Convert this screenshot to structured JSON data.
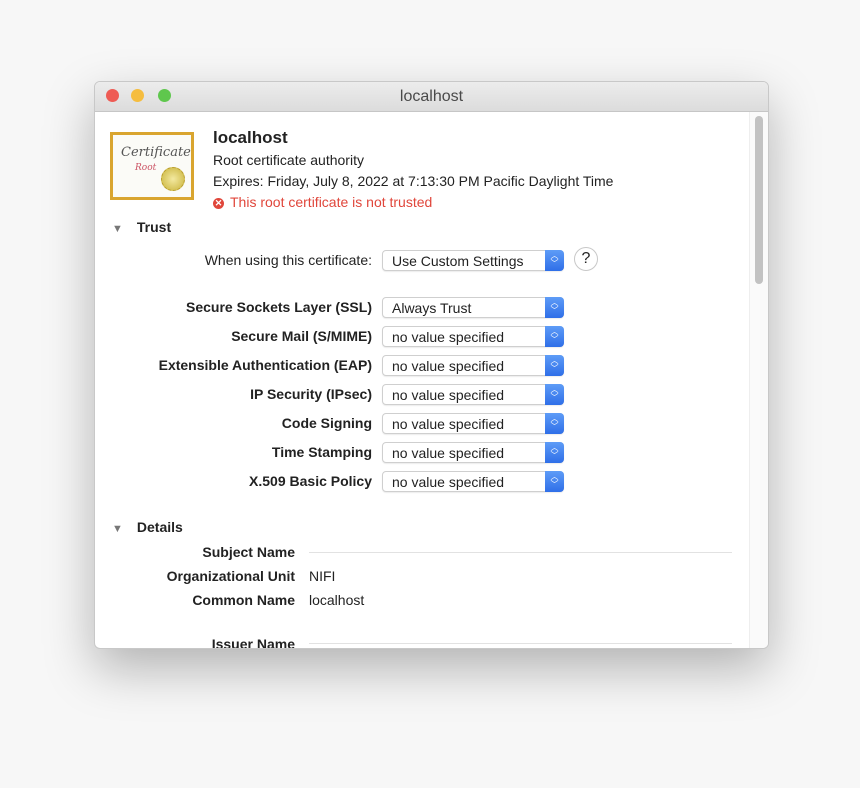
{
  "window": {
    "title": "localhost"
  },
  "header": {
    "name": "localhost",
    "kind": "Root certificate authority",
    "expires": "Expires: Friday, July 8, 2022 at 7:13:30 PM Pacific Daylight Time",
    "warning": "This root certificate is not trusted",
    "icon_text": "Certificate",
    "icon_subtext": "Root"
  },
  "trust": {
    "section": "Trust",
    "when_label": "When using this certificate:",
    "when_value": "Use Custom Settings",
    "help": "?",
    "rows": [
      {
        "label": "Secure Sockets Layer (SSL)",
        "value": "Always Trust"
      },
      {
        "label": "Secure Mail (S/MIME)",
        "value": "no value specified"
      },
      {
        "label": "Extensible Authentication (EAP)",
        "value": "no value specified"
      },
      {
        "label": "IP Security (IPsec)",
        "value": "no value specified"
      },
      {
        "label": "Code Signing",
        "value": "no value specified"
      },
      {
        "label": "Time Stamping",
        "value": "no value specified"
      },
      {
        "label": "X.509 Basic Policy",
        "value": "no value specified"
      }
    ]
  },
  "details": {
    "section": "Details",
    "subject_name": "Subject Name",
    "org_unit_label": "Organizational Unit",
    "org_unit": "NIFI",
    "common_name_label": "Common Name",
    "common_name": "localhost",
    "issuer_name": "Issuer Name"
  },
  "colors": {
    "accent": "#2f6fe8",
    "error": "#e0463b",
    "close": "#ee5b54",
    "minimize": "#f5bd3f",
    "zoom": "#5fc74d"
  }
}
